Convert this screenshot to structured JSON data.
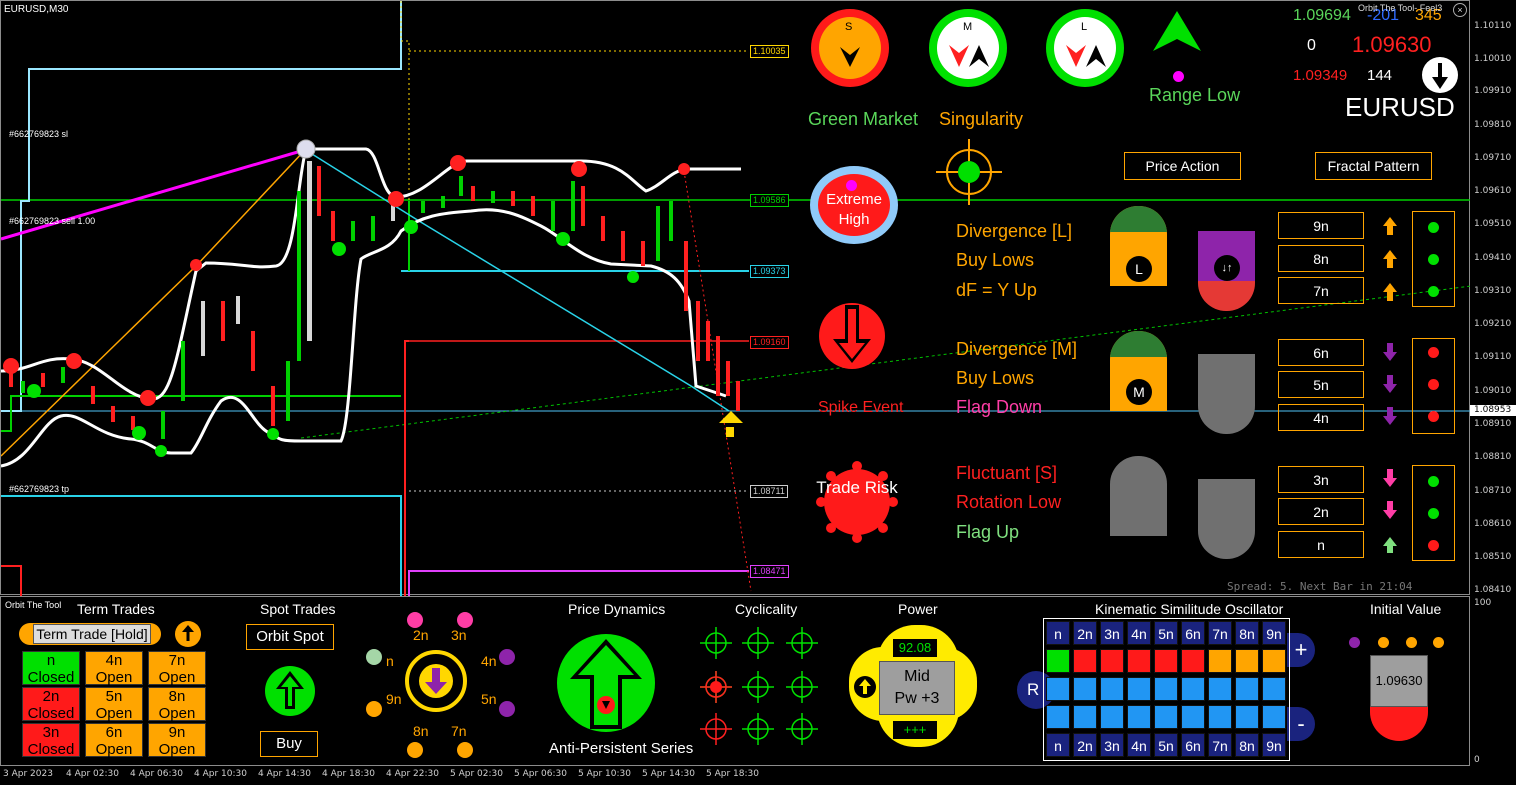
{
  "chart": {
    "symbol_tf": "EURUSD,M30",
    "indicator_title": "Orbit The Tool- Feel3",
    "order_sl_label": "#662769823 sl",
    "order_sell_label": "#662769823 sell 1.00",
    "order_tp_label": "#662769823 tp",
    "spread_text": "Spread: 5.  Next Bar in 21:04",
    "level_labels": [
      "1.10035",
      "1.09586",
      "1.09373",
      "1.09160",
      "1.08711",
      "1.08471"
    ],
    "price_ticks": [
      "1.10110",
      "1.10010",
      "1.09910",
      "1.09810",
      "1.09710",
      "1.09610",
      "1.09510",
      "1.09410",
      "1.09310",
      "1.09210",
      "1.09110",
      "1.09010",
      "1.08953",
      "1.08910",
      "1.08810",
      "1.08710",
      "1.08610",
      "1.08510",
      "1.08410"
    ],
    "sub_ticks": [
      "100",
      "0"
    ],
    "time_labels": [
      "3 Apr 2023",
      "4 Apr 02:30",
      "4 Apr 06:30",
      "4 Apr 10:30",
      "4 Apr 14:30",
      "4 Apr 18:30",
      "4 Apr 22:30",
      "5 Apr 02:30",
      "5 Apr 06:30",
      "5 Apr 10:30",
      "5 Apr 14:30",
      "5 Apr 18:30"
    ]
  },
  "quote": {
    "bid": "1.09694",
    "change_neg": "-201",
    "change_pos": "345",
    "zero": "0",
    "price": "1.09630",
    "low": "1.09349",
    "count": "144",
    "symbol": "EURUSD"
  },
  "top_panel": {
    "circle_s": "S",
    "circle_m": "M",
    "circle_l": "L",
    "green_market": "Green Market",
    "singularity": "Singularity",
    "range_low": "Range Low",
    "price_action": "Price Action",
    "fractal_pattern": "Fractal Pattern",
    "extreme_high": "Extreme High",
    "spike_event": "Spike Event",
    "trade_risk": "Trade Risk"
  },
  "divergence": {
    "l": {
      "title": "Divergence [L]",
      "line2": "Buy Lows",
      "line3": "dF = Y Up",
      "badge": "L"
    },
    "m": {
      "title": "Divergence [M]",
      "line2": "Buy Lows",
      "line3": "Flag Down",
      "badge": "M"
    },
    "s": {
      "title": "Fluctuant [S]",
      "line2": "Rotation Low",
      "line3": "Flag Up"
    }
  },
  "nboxes": [
    "9n",
    "8n",
    "7n",
    "6n",
    "5n",
    "4n",
    "3n",
    "2n",
    "n"
  ],
  "sub_panel": {
    "label": "Orbit The Tool",
    "term_trades": "Term Trades",
    "term_button": "Term Trade [Hold]",
    "term_cells": [
      {
        "n": "n",
        "s": "Closed"
      },
      {
        "n": "4n",
        "s": "Open"
      },
      {
        "n": "7n",
        "s": "Open"
      },
      {
        "n": "2n",
        "s": "Closed"
      },
      {
        "n": "5n",
        "s": "Open"
      },
      {
        "n": "8n",
        "s": "Open"
      },
      {
        "n": "3n",
        "s": "Closed"
      },
      {
        "n": "6n",
        "s": "Open"
      },
      {
        "n": "9n",
        "s": "Open"
      }
    ],
    "spot_trades": "Spot Trades",
    "orbit_spot": "Orbit Spot",
    "buy": "Buy",
    "orbit_labels": {
      "a": "2n",
      "b": "3n",
      "c": "n",
      "d": "4n",
      "e": "9n",
      "f": "5n",
      "g": "8n",
      "h": "7n"
    },
    "price_dynamics": "Price Dynamics",
    "anti_persistent": "Anti-Persistent Series",
    "cyclicality": "Cyclicality",
    "power": "Power",
    "power_value": "92.08",
    "power_mid": "Mid",
    "power_pw": "Pw +3",
    "power_plus": "+++",
    "kinematic": "Kinematic Similitude Oscillator",
    "k_labels": [
      "n",
      "2n",
      "3n",
      "4n",
      "5n",
      "6n",
      "7n",
      "8n",
      "9n"
    ],
    "k_plus": "+",
    "k_minus": "-",
    "k_r": "R",
    "initial_value": "Initial Value",
    "initial_price": "1.09630"
  },
  "colors": {
    "green": "#00ff00",
    "red": "#ff0000",
    "orange": "#ffa500",
    "cyan": "#00ffff",
    "magenta": "#ff00ff"
  }
}
